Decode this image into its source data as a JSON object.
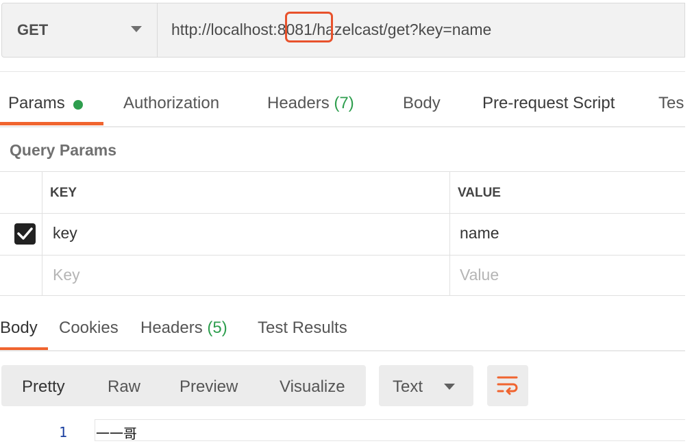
{
  "request": {
    "method": "GET",
    "url": "http://localhost:8081/hazelcast/get?key=name"
  },
  "request_tabs": {
    "params": "Params",
    "authorization": "Authorization",
    "headers": "Headers",
    "headers_count": "(7)",
    "body": "Body",
    "prerequest": "Pre-request Script",
    "tests": "Tes"
  },
  "query_params": {
    "title": "Query Params",
    "columns": {
      "key": "KEY",
      "value": "VALUE"
    },
    "rows": [
      {
        "checked": true,
        "key": "key",
        "value": "name"
      }
    ],
    "placeholders": {
      "key": "Key",
      "value": "Value"
    }
  },
  "response_tabs": {
    "body": "Body",
    "cookies": "Cookies",
    "headers": "Headers",
    "headers_count": "(5)",
    "test_results": "Test Results"
  },
  "response_toolbar": {
    "views": [
      "Pretty",
      "Raw",
      "Preview",
      "Visualize"
    ],
    "format": "Text"
  },
  "response_body": {
    "lines": [
      {
        "number": "1",
        "text": "一一哥"
      }
    ]
  },
  "colors": {
    "accent": "#f0642f",
    "highlight_box": "#e8522c",
    "count_green": "#2e9e4e"
  },
  "icons": {
    "method_dropdown": "chevron-down-icon",
    "checkbox": "checkbox-checked-icon",
    "wrap": "wrap-lines-icon"
  }
}
